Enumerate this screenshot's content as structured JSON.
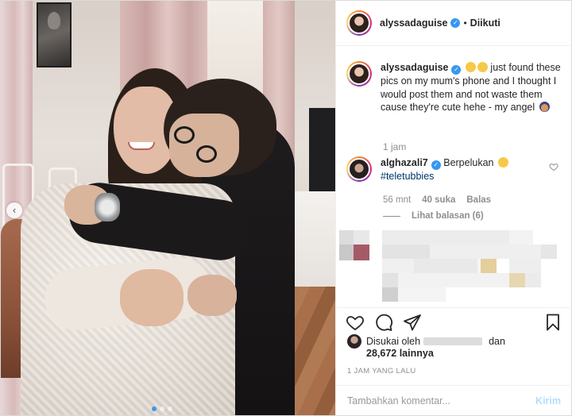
{
  "post": {
    "author": "alyssadaguise",
    "follow_status": "Diikuti",
    "follow_separator": "•"
  },
  "caption": {
    "username": "alyssadaguise",
    "text": " just found these pics on my mum's phone and I thought I would post them and not waste them cause they're cute hehe - my angel ",
    "time": "1 jam"
  },
  "comment": {
    "username": "alghazali7",
    "text": "Berpelukan ",
    "hashtag": "#teletubbies",
    "time": "56 mnt",
    "likes": "40 suka",
    "reply": "Balas",
    "view_replies": "Lihat balasan (6)"
  },
  "likes": {
    "liked_by_prefix": "Disukai oleh",
    "liked_by_suffix": "dan",
    "count": "28,672 lainnya"
  },
  "posted": "1 JAM YANG LALU",
  "comment_box": {
    "placeholder": "Tambahkan komentar...",
    "send": "Kirim"
  },
  "colors": {
    "verified": "#3897f0",
    "hashtag": "#003569",
    "send_disabled": "#b2dffc",
    "secondary_text": "#8e8e8e"
  },
  "icons": [
    "heart-icon",
    "comment-icon",
    "share-icon",
    "bookmark-icon",
    "verified-icon",
    "chevron-left-icon"
  ]
}
